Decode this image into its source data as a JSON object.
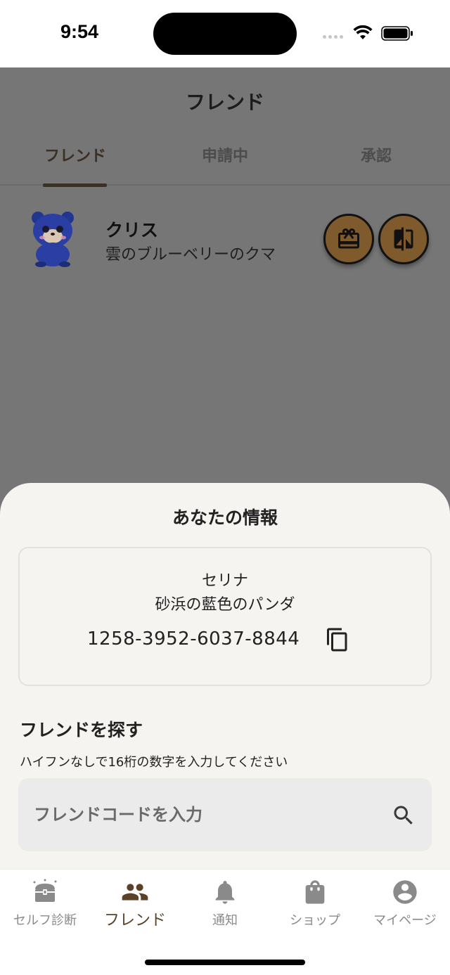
{
  "status_bar": {
    "time": "9:54"
  },
  "header": {
    "title": "フレンド"
  },
  "tabs": [
    {
      "label": "フレンド",
      "active": true
    },
    {
      "label": "申請中",
      "active": false
    },
    {
      "label": "承認",
      "active": false
    }
  ],
  "friends": [
    {
      "name": "クリス",
      "subtitle": "雲のブルーベリーのクマ",
      "avatar": "blue-bear-avatar"
    }
  ],
  "sheet": {
    "title": "あなたの情報",
    "my_info": {
      "name": "セリナ",
      "animal": "砂浜の藍色のパンダ",
      "friend_code": "1258-3952-6037-8844"
    },
    "find": {
      "title": "フレンドを探す",
      "hint": "ハイフンなしで16桁の数字を入力してください",
      "placeholder": "フレンドコードを入力",
      "value": ""
    }
  },
  "bottom_nav": [
    {
      "label": "セルフ診断",
      "icon": "treasure-chest-icon",
      "active": false
    },
    {
      "label": "フレンド",
      "icon": "people-icon",
      "active": true
    },
    {
      "label": "通知",
      "icon": "bell-icon",
      "active": false
    },
    {
      "label": "ショップ",
      "icon": "shopping-bag-icon",
      "active": false
    },
    {
      "label": "マイページ",
      "icon": "account-circle-icon",
      "active": false
    }
  ],
  "colors": {
    "accent_brown": "#7f5a2c",
    "active_nav": "#5a4228",
    "overlay_gray": "#767676",
    "sheet_bg": "#f5f4f0"
  }
}
